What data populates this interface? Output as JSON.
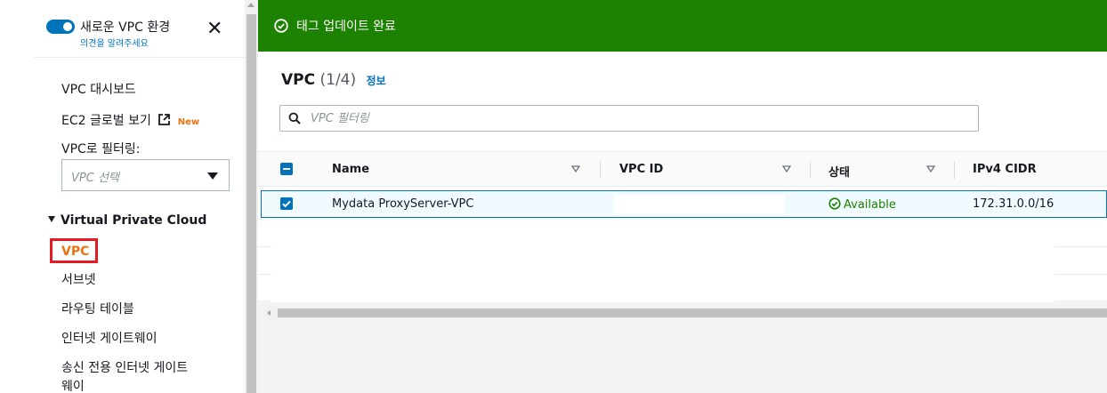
{
  "sidebar": {
    "toggle_title": "새로운 VPC 환경",
    "toggle_sub": "의견을 알려주세요",
    "nav_dashboard": "VPC 대시보드",
    "nav_ec2_global": "EC2 글로벌 보기",
    "nav_ec2_badge": "New",
    "filter_label": "VPC로 필터링:",
    "filter_placeholder": "VPC 선택",
    "section_title": "Virtual Private Cloud",
    "items": [
      "VPC",
      "서브넷",
      "라우팅 테이블",
      "인터넷 게이트웨이",
      "송신 전용 인터넷 게이트",
      "웨이"
    ]
  },
  "flash": {
    "message": "태그 업데이트 완료",
    "color": "#1d8102"
  },
  "panel": {
    "title": "VPC",
    "count": "(1/4)",
    "info_link": "정보",
    "filter_placeholder": "VPC 필터링"
  },
  "table": {
    "columns": [
      "Name",
      "VPC ID",
      "상태",
      "IPv4 CIDR"
    ],
    "rows": [
      {
        "name": "Mydata ProxyServer-VPC",
        "vpc_id": "",
        "status": "Available",
        "cidr": "172.31.0.0/16",
        "selected": true
      }
    ]
  },
  "colors": {
    "accent": "#0073bb",
    "active_nav": "#ec7211",
    "highlight_box": "#e51b24",
    "success": "#1d8102"
  }
}
